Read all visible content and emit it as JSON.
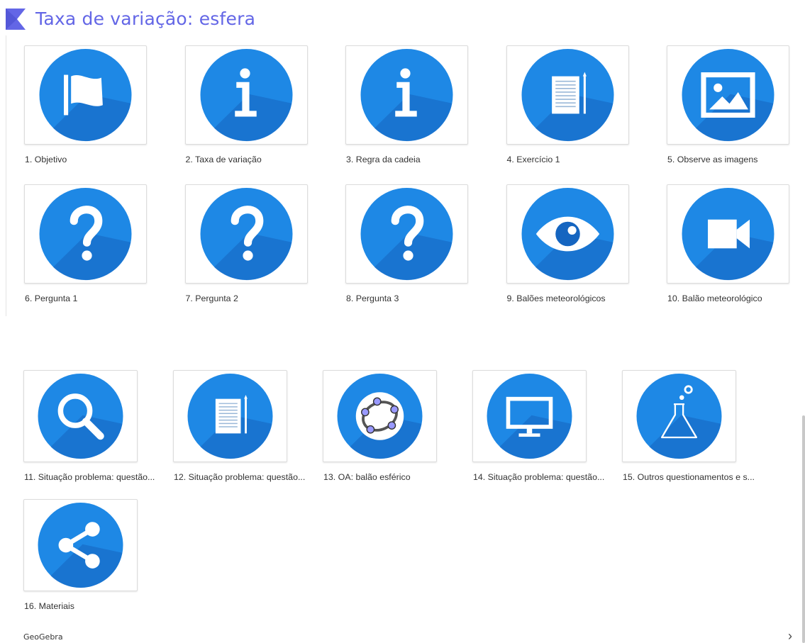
{
  "header": {
    "title": "Taxa de variação: esfera"
  },
  "colors": {
    "accent": "#1e88e5",
    "title": "#6366e6"
  },
  "section_a": {
    "items": [
      {
        "label": "1. Objetivo",
        "icon": "flag-icon"
      },
      {
        "label": "2. Taxa de variação",
        "icon": "info-icon"
      },
      {
        "label": "3. Regra da cadeia",
        "icon": "info-icon"
      },
      {
        "label": "4. Exercício 1",
        "icon": "document-icon"
      },
      {
        "label": "5. Observe as imagens",
        "icon": "image-icon"
      },
      {
        "label": "6. Pergunta 1",
        "icon": "question-icon"
      },
      {
        "label": "7. Pergunta 2",
        "icon": "question-icon"
      },
      {
        "label": "8. Pergunta 3",
        "icon": "question-icon"
      },
      {
        "label": "9. Balões meteorológicos",
        "icon": "eye-icon"
      },
      {
        "label": "10. Balão meteorológico",
        "icon": "video-camera-icon"
      }
    ]
  },
  "section_b": {
    "items": [
      {
        "label": "11. Situação problema: questão...",
        "icon": "search-icon"
      },
      {
        "label": "12. Situação problema: questão...",
        "icon": "document-icon"
      },
      {
        "label": "13. OA: balão esférico",
        "icon": "geogebra-icon"
      },
      {
        "label": "14. Situação problema: questão...",
        "icon": "monitor-icon"
      },
      {
        "label": "15. Outros questionamentos e s...",
        "icon": "flask-icon"
      },
      {
        "label": "16. Materiais",
        "icon": "share-icon"
      }
    ]
  },
  "footer": {
    "logo": "GeoGebra",
    "next_arrow": "›"
  }
}
